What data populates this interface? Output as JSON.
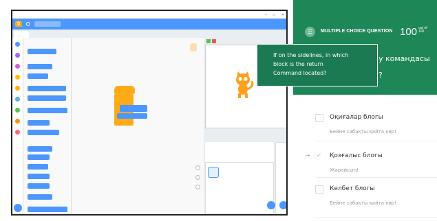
{
  "quiz": {
    "type_label": "MULTIPLE CHOICE QUESTION",
    "score": "100",
    "out_of_label": "out of",
    "out_of_value": "100",
    "question_line1": "у командасы",
    "question_line2": "?",
    "options": [
      {
        "label": "Оқиғалар блогы",
        "subtitle": "Бейне сабақты қайта көр!",
        "selected": false
      },
      {
        "label": "Қозғалыс блогы",
        "subtitle": "Жарайсың!",
        "selected": true
      },
      {
        "label": "Келбет блогы",
        "subtitle": "Бейне сабақты қайта көр!",
        "selected": false
      }
    ]
  },
  "tooltip": {
    "line1": "If on the sidelines, in which",
    "line2": "block is the return",
    "line3": "Command located?"
  },
  "colors": {
    "quiz_green": "#1e8758",
    "tooltip_green": "#1c7a52",
    "scratch_blue": "#4c97ff",
    "scratch_orange": "#ffab19"
  },
  "icons": [
    "list-icon",
    "arrow-right-icon",
    "check-icon",
    "cat-sprite-icon",
    "green-flag-icon",
    "stop-icon",
    "add-sprite-icon",
    "add-backdrop-icon"
  ]
}
